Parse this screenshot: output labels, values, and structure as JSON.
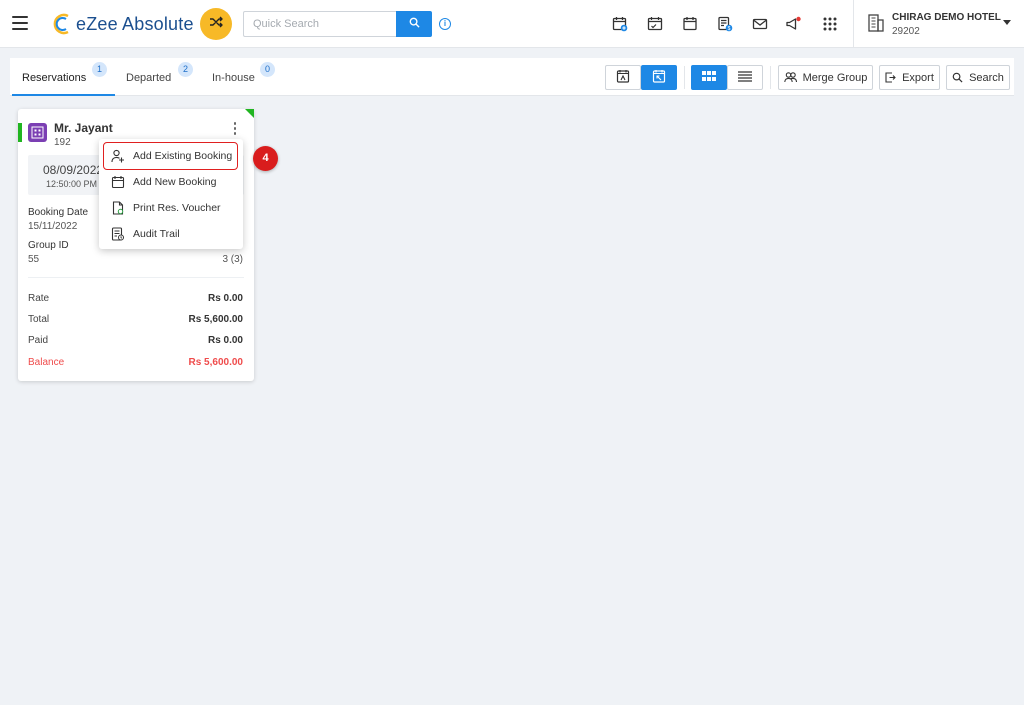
{
  "header": {
    "app_name": "eZee Absolute",
    "search_placeholder": "Quick Search",
    "hotel_name": "CHIRAG DEMO HOTEL",
    "hotel_id": "29202",
    "icons": [
      "menu-icon",
      "shuffle-icon",
      "search-icon",
      "info-icon",
      "calendar-plus-icon",
      "calendar-check-icon",
      "calendar-icon",
      "invoice-icon",
      "mail-icon",
      "announcement-icon",
      "apps-grid-icon",
      "building-icon",
      "caret-down-icon"
    ],
    "colors": {
      "brand": "#1b4f8f",
      "accent": "#1e88e5",
      "shuffle": "#f7b927"
    }
  },
  "tabs": [
    {
      "label": "Reservations",
      "count": "1",
      "active": true
    },
    {
      "label": "Departed",
      "count": "2",
      "active": false
    },
    {
      "label": "In-house",
      "count": "0",
      "active": false
    }
  ],
  "toolbar": {
    "merge_group": "Merge Group",
    "export": "Export",
    "search": "Search"
  },
  "card": {
    "guest_name": "Mr. Jayant",
    "room": "192",
    "arrival_date": "08/09/2022",
    "arrival_time": "12:50:00 PM",
    "booking_date_label": "Booking Date",
    "booking_date": "15/11/2022",
    "group_id_label": "Group ID",
    "group_id": "55",
    "rooms_count": "3 (3)",
    "rate_label": "Rate",
    "rate": "Rs 0.00",
    "total_label": "Total",
    "total": "Rs 5,600.00",
    "paid_label": "Paid",
    "paid": "Rs 0.00",
    "balance_label": "Balance",
    "balance": "Rs 5,600.00",
    "status_color": "#21b521",
    "balance_color": "#ef4b4b"
  },
  "menu": {
    "items": [
      {
        "label": "Add Existing Booking",
        "icon": "user-add-icon"
      },
      {
        "label": "Add New Booking",
        "icon": "calendar-icon"
      },
      {
        "label": "Print Res. Voucher",
        "icon": "document-icon"
      },
      {
        "label": "Audit Trail",
        "icon": "audit-icon"
      }
    ]
  },
  "annotation": {
    "step": "4"
  }
}
